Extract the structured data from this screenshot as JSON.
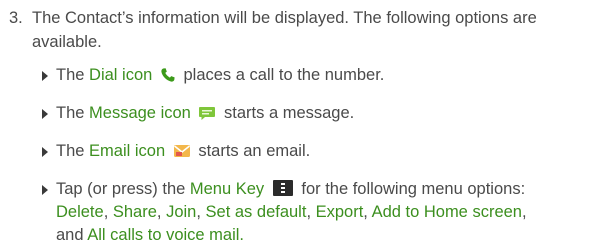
{
  "step": {
    "number": "3.",
    "line1": "The Contact’s information will be displayed. The following options are",
    "line2": "available."
  },
  "bullets": [
    {
      "before": "The ",
      "term": "Dial icon",
      "after": " places a call to the number.",
      "icon": "phone-icon"
    },
    {
      "before": "The ",
      "term": "Message icon",
      "after": " starts a message.",
      "icon": "message-icon"
    },
    {
      "before": "The ",
      "term": "Email icon",
      "after": " starts an email.",
      "icon": "email-icon"
    },
    {
      "before": "Tap (or press) the ",
      "term": "Menu Key",
      "after": " for the following menu options:",
      "icon": "menu-key-icon",
      "options": [
        "Delete",
        "Share",
        "Join",
        "Set as default",
        "Export",
        "Add to Home screen",
        "All calls to voice mail."
      ],
      "sep": ", ",
      "and": "and "
    }
  ],
  "colors": {
    "text": "#4a4a4a",
    "accent": "#3c8f1f"
  }
}
